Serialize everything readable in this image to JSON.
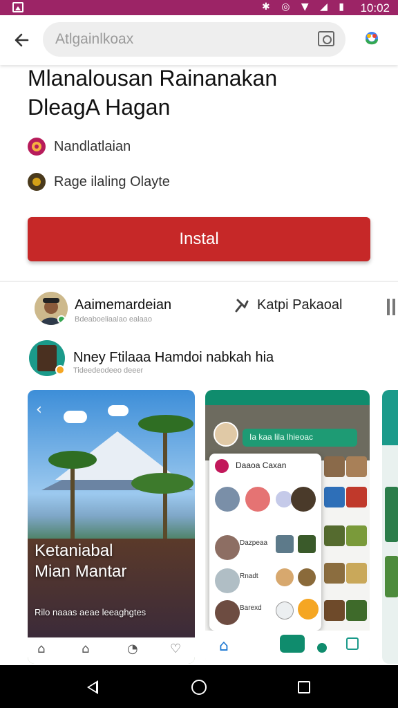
{
  "status_bar": {
    "time": "10:02",
    "icons": "✱ ◎ ▼ ◢ ▮"
  },
  "top_bar": {
    "search_text": "Atlgainlkoax"
  },
  "app": {
    "title_line1": "Mlanalousan Rainanakan",
    "title_line2": "DleagA Hagan",
    "meta1": "Nandlatlaian",
    "meta2": "Rage ilaling Olayte",
    "install_label": "Instal",
    "accent_color": "#c62828",
    "status_color": "#9c2466"
  },
  "developer_row": {
    "name": "Aaimemardeian",
    "sub": "Bdeaboeliaalao ealaao",
    "tag": "Katpi Pakaoal"
  },
  "related_row": {
    "name": "Nney Ftilaaa Hamdoi nabkah hia",
    "sub": "Tideedeodeeo deeer"
  },
  "screenshots": {
    "s1_caption_line1": "Ketaniabal",
    "s1_caption_line2": "Mian Mantar",
    "s1_caption_sub": "Rilo naaas aeae leeaghgtes",
    "s2_search": "Ia kaa lila lhieoac",
    "s2_panel_title": "Daaoa Caxan",
    "s2_rows": [
      "Dazpeaa",
      "Rnadt",
      "Barexd"
    ]
  }
}
